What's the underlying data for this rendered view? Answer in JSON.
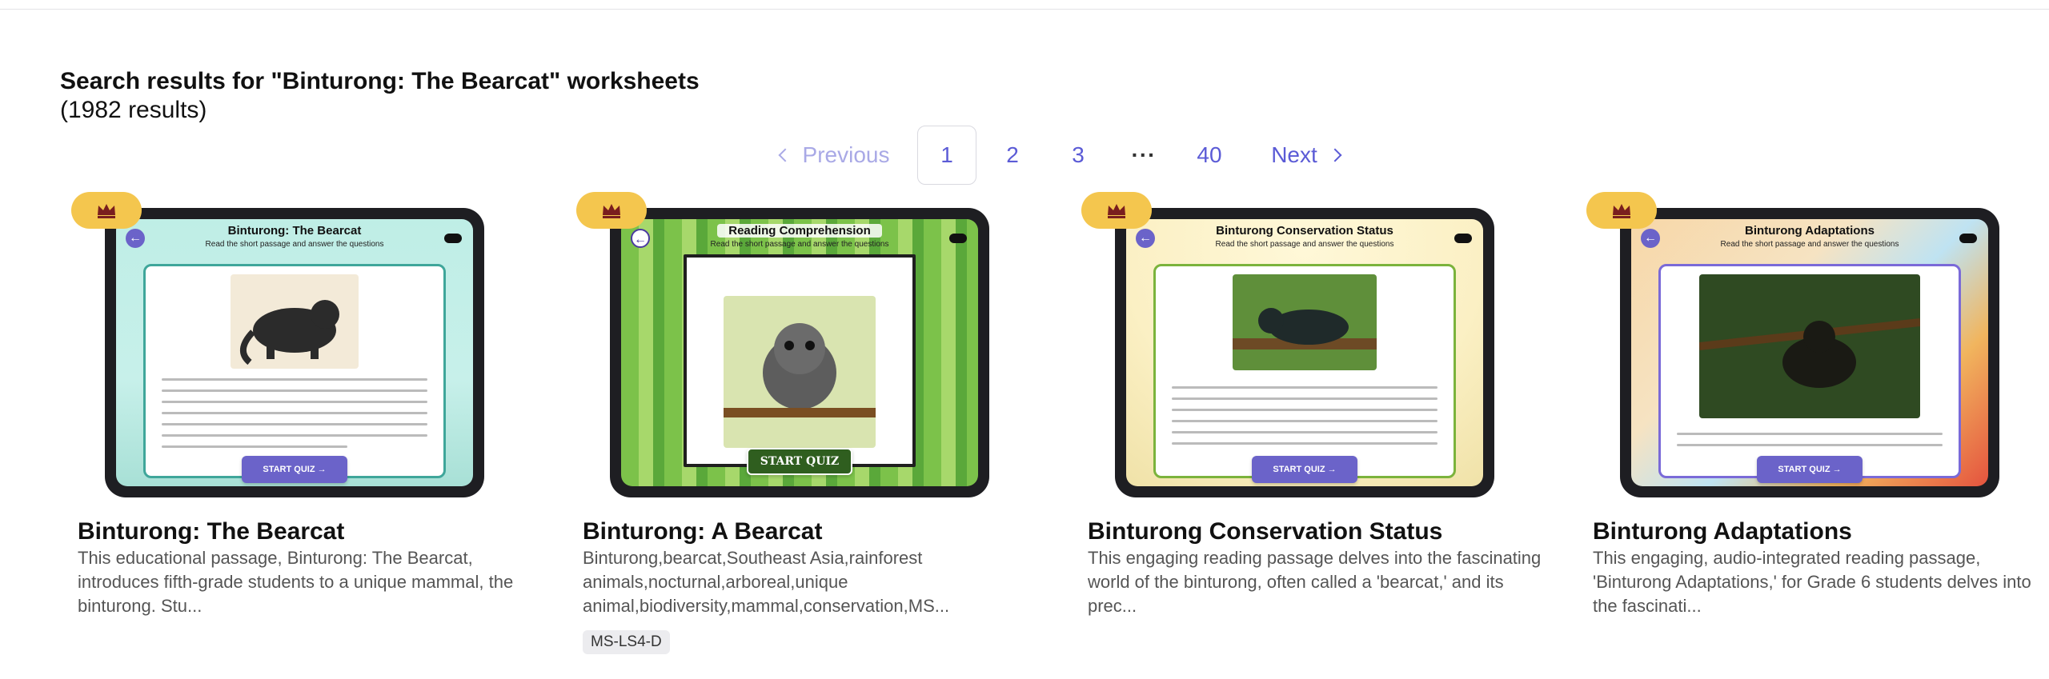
{
  "search": {
    "title": "Search results for \"Binturong: The Bearcat\" worksheets",
    "count": "(1982 results)"
  },
  "pagination": {
    "previous": "Previous",
    "pages": [
      "1",
      "2",
      "3"
    ],
    "ellipsis": "···",
    "last": "40",
    "next": "Next",
    "current": "1"
  },
  "colors": {
    "accent": "#5b5bd6",
    "premium_badge": "#f4c64e",
    "start_button": "#6b63c9"
  },
  "cards": [
    {
      "title": "Binturong: The Bearcat",
      "description": "This educational passage, Binturong: The Bearcat, introduces fifth-grade students to a unique mammal, the binturong. Stu...",
      "thumb_title": "Binturong: The Bearcat",
      "thumb_subtitle": "Read the short passage and answer the questions",
      "start_label": "START QUIZ →",
      "premium_icon": "crown-icon"
    },
    {
      "title": "Binturong: A Bearcat",
      "description": "Binturong,bearcat,Southeast Asia,rainforest animals,nocturnal,arboreal,unique animal,biodiversity,mammal,conservation,MS...",
      "thumb_title": "Reading Comprehension",
      "thumb_subtitle": "Read the short passage and answer the questions",
      "start_label": "START QUIZ",
      "tag": "MS-LS4-D",
      "premium_icon": "crown-icon"
    },
    {
      "title": "Binturong Conservation Status",
      "description": "This engaging reading passage delves into the fascinating world of the binturong, often called a 'bearcat,' and its prec...",
      "thumb_title": "Binturong Conservation Status",
      "thumb_subtitle": "Read the short passage and answer the questions",
      "start_label": "START QUIZ →",
      "premium_icon": "crown-icon"
    },
    {
      "title": "Binturong Adaptations",
      "description": "This engaging, audio-integrated reading passage, 'Binturong Adaptations,' for Grade 6 students delves into the fascinati...",
      "thumb_title": "Binturong Adaptations",
      "thumb_subtitle": "Read the short passage and answer the questions",
      "start_label": "START QUIZ →",
      "premium_icon": "crown-icon"
    }
  ]
}
